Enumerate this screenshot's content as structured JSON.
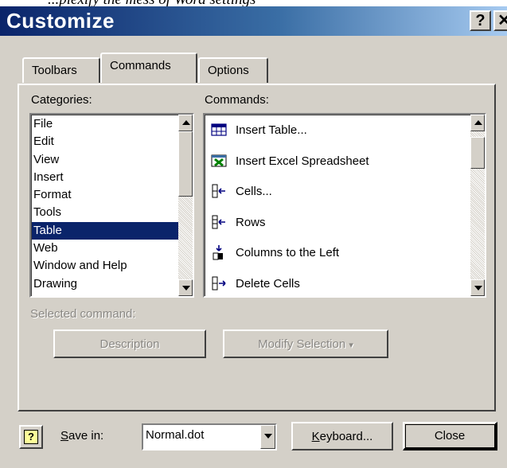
{
  "caption": "...plexify the mess of Word settings",
  "window": {
    "title": "Customize",
    "help_glyph": "?",
    "close_glyph": "✕"
  },
  "tabs": [
    {
      "label": "Toolbars",
      "active": false
    },
    {
      "label": "Commands",
      "active": true
    },
    {
      "label": "Options",
      "active": false
    }
  ],
  "categories": {
    "label": "Categories:",
    "items": [
      "File",
      "Edit",
      "View",
      "Insert",
      "Format",
      "Tools",
      "Table",
      "Web",
      "Window and Help",
      "Drawing"
    ],
    "selected": "Table"
  },
  "commands": {
    "label": "Commands:",
    "items": [
      {
        "label": "Insert Table...",
        "icon": "insert-table-icon"
      },
      {
        "label": "Insert Excel Spreadsheet",
        "icon": "excel-spreadsheet-icon"
      },
      {
        "label": "Cells...",
        "icon": "insert-cells-icon"
      },
      {
        "label": "Rows",
        "icon": "insert-rows-icon"
      },
      {
        "label": "Columns to the Left",
        "icon": "insert-columns-left-icon"
      },
      {
        "label": "Delete Cells",
        "icon": "delete-cells-icon"
      }
    ]
  },
  "selected_command": {
    "label": "Selected command:",
    "description_button": "Description",
    "modify_button": "Modify Selection",
    "modify_arrow": "▾"
  },
  "footer": {
    "help_icon_glyph": "?",
    "save_in_label": "Save in:",
    "save_in_value": "Normal.dot",
    "keyboard_button": "Keyboard...",
    "close_button": "Close"
  },
  "colors": {
    "dialog_face": "#d4d0c8",
    "title_start": "#0a246a",
    "title_end": "#a6caf0",
    "selection": "#0a246a"
  }
}
